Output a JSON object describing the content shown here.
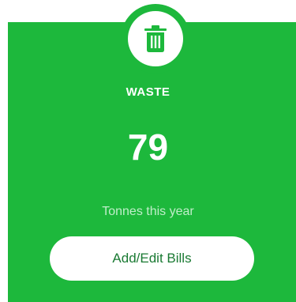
{
  "card": {
    "icon": "trash-bin-icon",
    "category": "WASTE",
    "value": "79",
    "unit": "Tonnes this year",
    "button_label": "Add/Edit Bills"
  },
  "colors": {
    "card_background": "#1db83c",
    "button_background": "#ffffff",
    "button_text": "#1a7a33",
    "primary_text": "#ffffff",
    "secondary_text": "#bfeec9"
  }
}
